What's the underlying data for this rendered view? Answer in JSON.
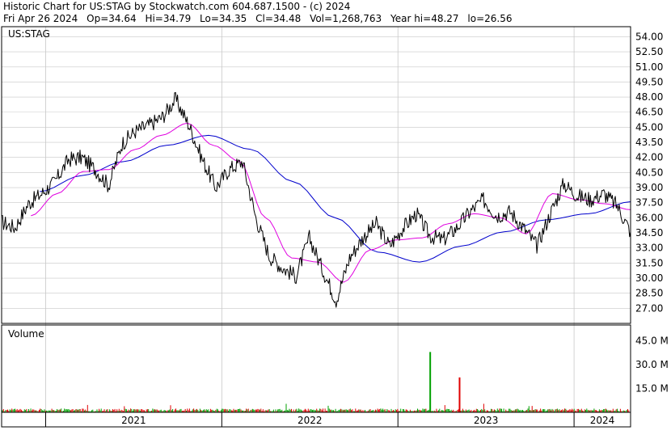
{
  "header": {
    "line1": "Historic Chart for US:STAG by Stockwatch.com 604.687.1500 - (c) 2024",
    "date": "Fri Apr 26 2024",
    "open": "Op=34.64",
    "high": "Hi=34.79",
    "low": "Lo=34.35",
    "close": "Cl=34.48",
    "volume": "Vol=1,268,763",
    "year_high": "Year hi=48.27",
    "year_low": "lo=26.56"
  },
  "price_panel": {
    "label": "US:STAG"
  },
  "volume_panel": {
    "label": "Volume"
  },
  "colors": {
    "price": "#000000",
    "ma_short": "#e000e0",
    "ma_long": "#0000cc",
    "volume_up": "#00a000",
    "volume_down": "#e00000",
    "grid": "#c8c8c8",
    "frame": "#000000"
  },
  "chart_data": [
    {
      "type": "line",
      "title": "Historic Chart for US:STAG",
      "ylim": [
        25.5,
        55
      ],
      "y_ticks": [
        "54.00",
        "52.50",
        "51.00",
        "49.50",
        "48.00",
        "46.50",
        "45.00",
        "43.50",
        "42.00",
        "40.50",
        "39.00",
        "37.50",
        "36.00",
        "34.50",
        "33.00",
        "31.50",
        "30.00",
        "28.50",
        "27.00"
      ],
      "x_ticks": [
        "2021",
        "2022",
        "2023",
        "2024"
      ],
      "x_range": [
        "2020-10",
        "2024-04"
      ],
      "series": [
        {
          "key": "price",
          "dates": [
            "2020-10",
            "2020-11",
            "2020-12",
            "2021-01",
            "2021-02",
            "2021-03",
            "2021-04",
            "2021-05",
            "2021-06",
            "2021-07",
            "2021-08",
            "2021-09",
            "2021-10",
            "2021-11",
            "2021-12",
            "2022-01",
            "2022-02",
            "2022-03",
            "2022-04",
            "2022-05",
            "2022-06",
            "2022-07",
            "2022-08",
            "2022-09",
            "2022-10",
            "2022-11",
            "2022-12",
            "2023-01",
            "2023-02",
            "2023-03",
            "2023-04",
            "2023-05",
            "2023-06",
            "2023-07",
            "2023-08",
            "2023-09",
            "2023-10",
            "2023-11",
            "2023-12",
            "2024-01",
            "2024-02",
            "2024-03",
            "2024-04"
          ],
          "values": [
            35.6,
            35.0,
            37.4,
            38.4,
            39.6,
            41.8,
            42.0,
            40.8,
            39.2,
            43.4,
            44.6,
            45.2,
            46.0,
            47.8,
            45.2,
            41.8,
            39.0,
            40.8,
            41.6,
            36.0,
            32.2,
            31.0,
            30.2,
            34.0,
            30.8,
            27.8,
            32.0,
            34.0,
            35.4,
            33.2,
            35.0,
            36.4,
            34.2,
            33.8,
            35.0,
            36.6,
            37.8,
            36.2,
            36.6,
            35.0,
            33.2,
            36.4,
            39.4,
            38.2,
            37.8,
            38.4,
            37.2,
            34.6
          ]
        },
        {
          "key": "ma_short",
          "dates": [
            "2020-12",
            "2021-02",
            "2021-04",
            "2021-06",
            "2021-08",
            "2021-10",
            "2021-12",
            "2022-02",
            "2022-04",
            "2022-06",
            "2022-08",
            "2022-10",
            "2022-12",
            "2023-02",
            "2023-04",
            "2023-06",
            "2023-08",
            "2023-10",
            "2023-12",
            "2024-02",
            "2024-04"
          ],
          "values": [
            36.2,
            38.4,
            40.6,
            40.8,
            42.8,
            44.2,
            45.4,
            43.2,
            41.6,
            36.0,
            32.0,
            31.6,
            29.6,
            32.8,
            33.8,
            34.0,
            35.4,
            36.4,
            36.0,
            34.4,
            38.4,
            37.8,
            37.4,
            36.8
          ]
        },
        {
          "key": "ma_long",
          "dates": [
            "2020-12",
            "2021-03",
            "2021-06",
            "2021-09",
            "2021-12",
            "2022-03",
            "2022-06",
            "2022-09",
            "2022-12",
            "2023-03",
            "2023-06",
            "2023-09",
            "2023-12",
            "2024-02",
            "2024-04"
          ],
          "values": [
            38.6,
            40.2,
            41.6,
            43.2,
            44.2,
            42.8,
            39.6,
            36.0,
            32.6,
            31.6,
            33.2,
            34.6,
            35.8,
            36.4,
            37.6
          ]
        }
      ]
    },
    {
      "type": "bar",
      "title": "Volume",
      "ylim": [
        0,
        55
      ],
      "y_ticks": [
        "45.0 M",
        "30.0 M",
        "15.0 M"
      ],
      "spikes": [
        {
          "date": "2023-03",
          "value": 38.0,
          "direction": "up"
        },
        {
          "date": "2023-05",
          "value": 22.0,
          "direction": "down"
        }
      ],
      "baseline_volume": 1.5
    }
  ]
}
